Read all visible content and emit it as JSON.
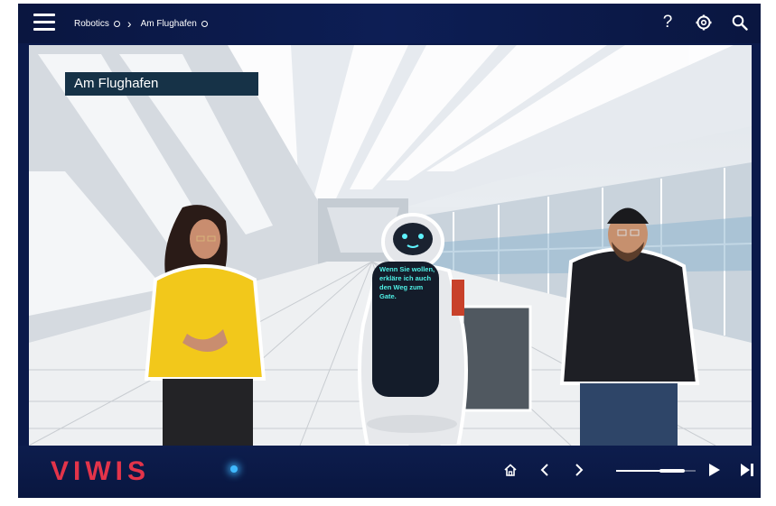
{
  "breadcrumb": {
    "items": [
      {
        "label": "Robotics"
      },
      {
        "label": "Am Flughafen"
      }
    ]
  },
  "header": {
    "icons": [
      "menu-icon",
      "help-icon",
      "settings-icon",
      "search-icon"
    ],
    "help_label": "?"
  },
  "scene": {
    "title": "Am Flughafen",
    "robot_speech": "Wenn Sie wollen, erkläre ich auch den Weg zum Gate."
  },
  "footer": {
    "logo": "VIWIS",
    "progress": 0.7,
    "icons": [
      "home-icon",
      "chevron-left-icon",
      "chevron-right-icon",
      "play-icon",
      "skip-end-icon"
    ]
  },
  "colors": {
    "bar_bg": "#0b1a4a",
    "logo": "#e3344a",
    "title_box": "#163247",
    "robot_screen_text": "#4ff0e6"
  }
}
